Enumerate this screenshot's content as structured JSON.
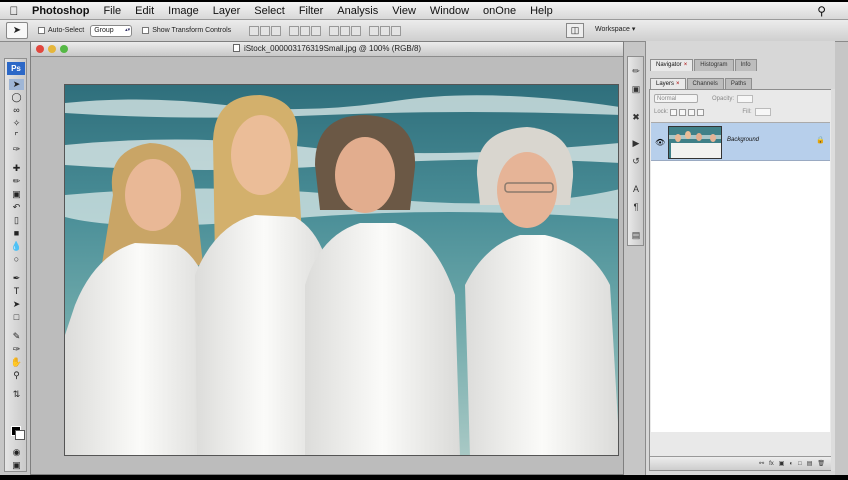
{
  "menubar": {
    "apple": "",
    "items": [
      "Photoshop",
      "File",
      "Edit",
      "Image",
      "Layer",
      "Select",
      "Filter",
      "Analysis",
      "View",
      "Window",
      "onOne",
      "Help"
    ],
    "spotlight_icon": "search-icon"
  },
  "options": {
    "auto_select_label": "Auto-Select",
    "auto_select_value": "Group",
    "transform_label": "Show Transform Controls",
    "workspace_label": "Workspace"
  },
  "document": {
    "title": "iStock_000003176319Small.jpg @ 100% (RGB/8)"
  },
  "panels": {
    "top_tabs": [
      "Navigator",
      "Histogram",
      "Info"
    ],
    "layer_tabs": [
      "Layers",
      "Channels",
      "Paths"
    ],
    "blend_mode": "Normal",
    "opacity_label": "Opacity:",
    "lock_label": "Lock:",
    "fill_label": "Fill:",
    "layer_name": "Background",
    "footer_icons": [
      "link-icon",
      "fx-icon",
      "mask-icon",
      "adjustment-icon",
      "group-icon",
      "new-layer-icon",
      "trash-icon"
    ]
  },
  "toolbox": {
    "logo": "Ps",
    "tools": [
      "move-tool",
      "marquee-tool",
      "lasso-tool",
      "quick-select-tool",
      "crop-tool",
      "eyedropper-tool",
      "healing-tool",
      "brush-tool",
      "clone-stamp-tool",
      "history-brush-tool",
      "eraser-tool",
      "gradient-tool",
      "blur-tool",
      "dodge-tool",
      "pen-tool",
      "type-tool",
      "path-select-tool",
      "shape-tool",
      "notes-tool",
      "hand-tool",
      "zoom-tool"
    ]
  },
  "colors": {
    "accent": "#2c68c7",
    "selected_layer": "#b7cfeb",
    "ocean": "#3d7a84",
    "shirt": "#f3f3f1"
  }
}
